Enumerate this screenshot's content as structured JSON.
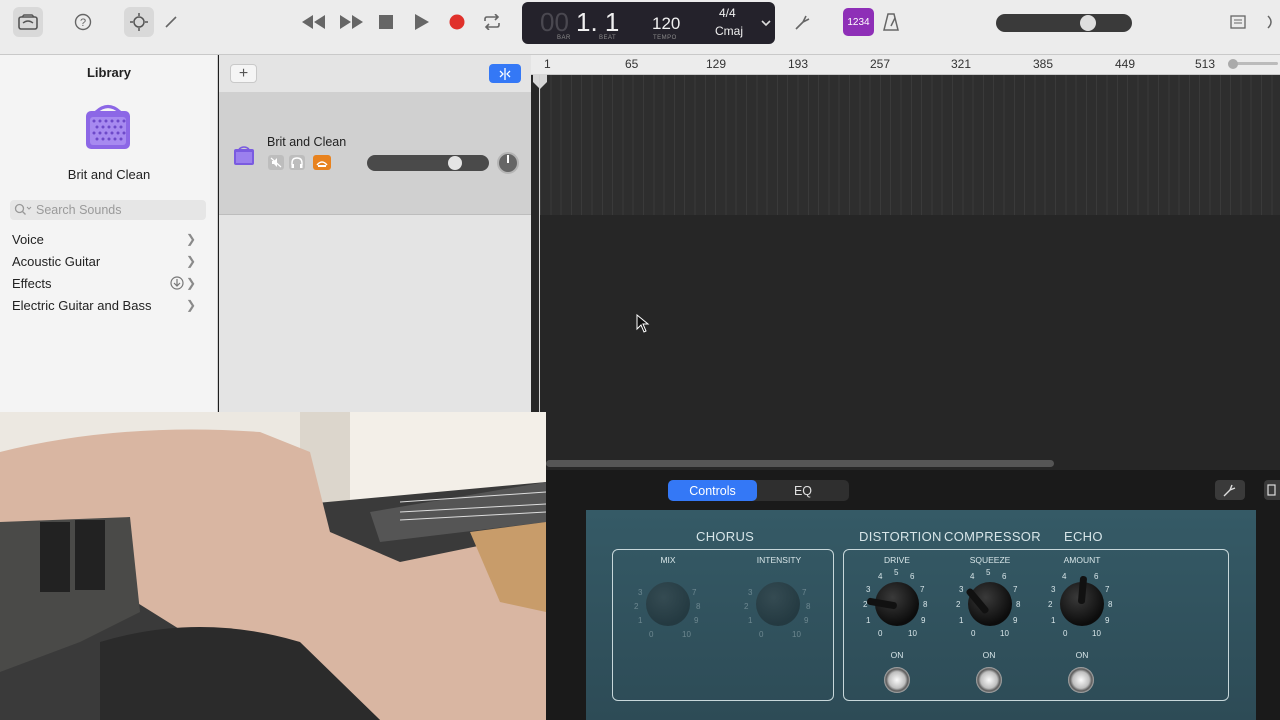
{
  "toolbar": {
    "lcd": {
      "bar_beat": "1. 1",
      "bar_prefix": "00",
      "bar_label": "BAR",
      "beat_label": "BEAT",
      "tempo": "120",
      "tempo_label": "TEMPO",
      "time_signature": "4/4",
      "key": "Cmaj"
    },
    "count_in": "1234"
  },
  "library": {
    "title": "Library",
    "patch_name": "Brit and Clean",
    "search_placeholder": "Search Sounds",
    "items": [
      {
        "label": "Voice"
      },
      {
        "label": "Acoustic Guitar"
      },
      {
        "label": "Effects"
      },
      {
        "label": "Electric Guitar and Bass"
      }
    ]
  },
  "track": {
    "name": "Brit and Clean",
    "volume": 0.75
  },
  "ruler": {
    "labels": [
      "1",
      "65",
      "129",
      "193",
      "257",
      "321",
      "385",
      "449",
      "513"
    ]
  },
  "smart_controls": {
    "tabs": [
      {
        "label": "Controls",
        "active": true
      },
      {
        "label": "EQ",
        "active": false
      }
    ],
    "sections": {
      "chorus": "CHORUS",
      "distortion": "DISTORTION",
      "compressor": "COMPRESSOR",
      "echo": "ECHO"
    },
    "knobs": {
      "mix": "MIX",
      "intensity": "INTENSITY",
      "drive": "DRIVE",
      "squeeze": "SQUEEZE",
      "amount": "AMOUNT"
    },
    "on_label": "ON"
  },
  "colors": {
    "accent_blue": "#3478f6",
    "amp_panel": "#31515c",
    "record_red": "#e0312b",
    "count_in_purple": "#8e2fb7"
  }
}
